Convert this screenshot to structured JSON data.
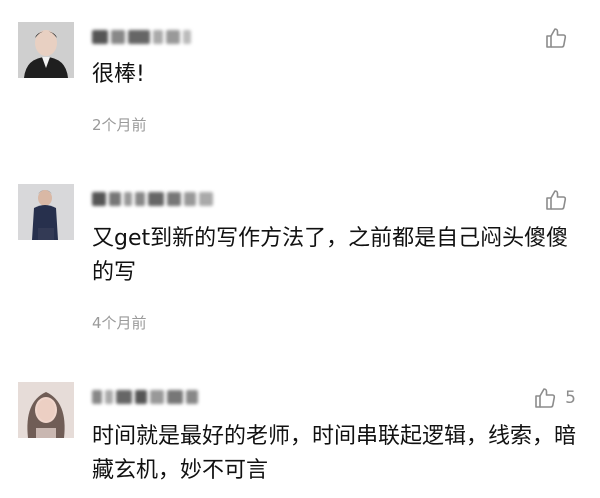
{
  "comments": [
    {
      "avatar_icon": "avatar-man-suit",
      "text": "很棒!",
      "time": "2个月前",
      "like_icon": "thumbs-up-icon",
      "like_count": ""
    },
    {
      "avatar_icon": "avatar-person-dark-outfit",
      "text": "又get到新的写作方法了，之前都是自己闷头傻傻的写",
      "time": "4个月前",
      "like_icon": "thumbs-up-icon",
      "like_count": ""
    },
    {
      "avatar_icon": "avatar-woman-blurred",
      "text": "时间就是最好的老师，时间串联起逻辑，线索，暗藏玄机，妙不可言",
      "time": "",
      "like_icon": "thumbs-up-icon",
      "like_count": "5"
    }
  ],
  "colors": {
    "text": "#111111",
    "meta": "#9a9a9a",
    "icon": "#8c8c8c"
  }
}
